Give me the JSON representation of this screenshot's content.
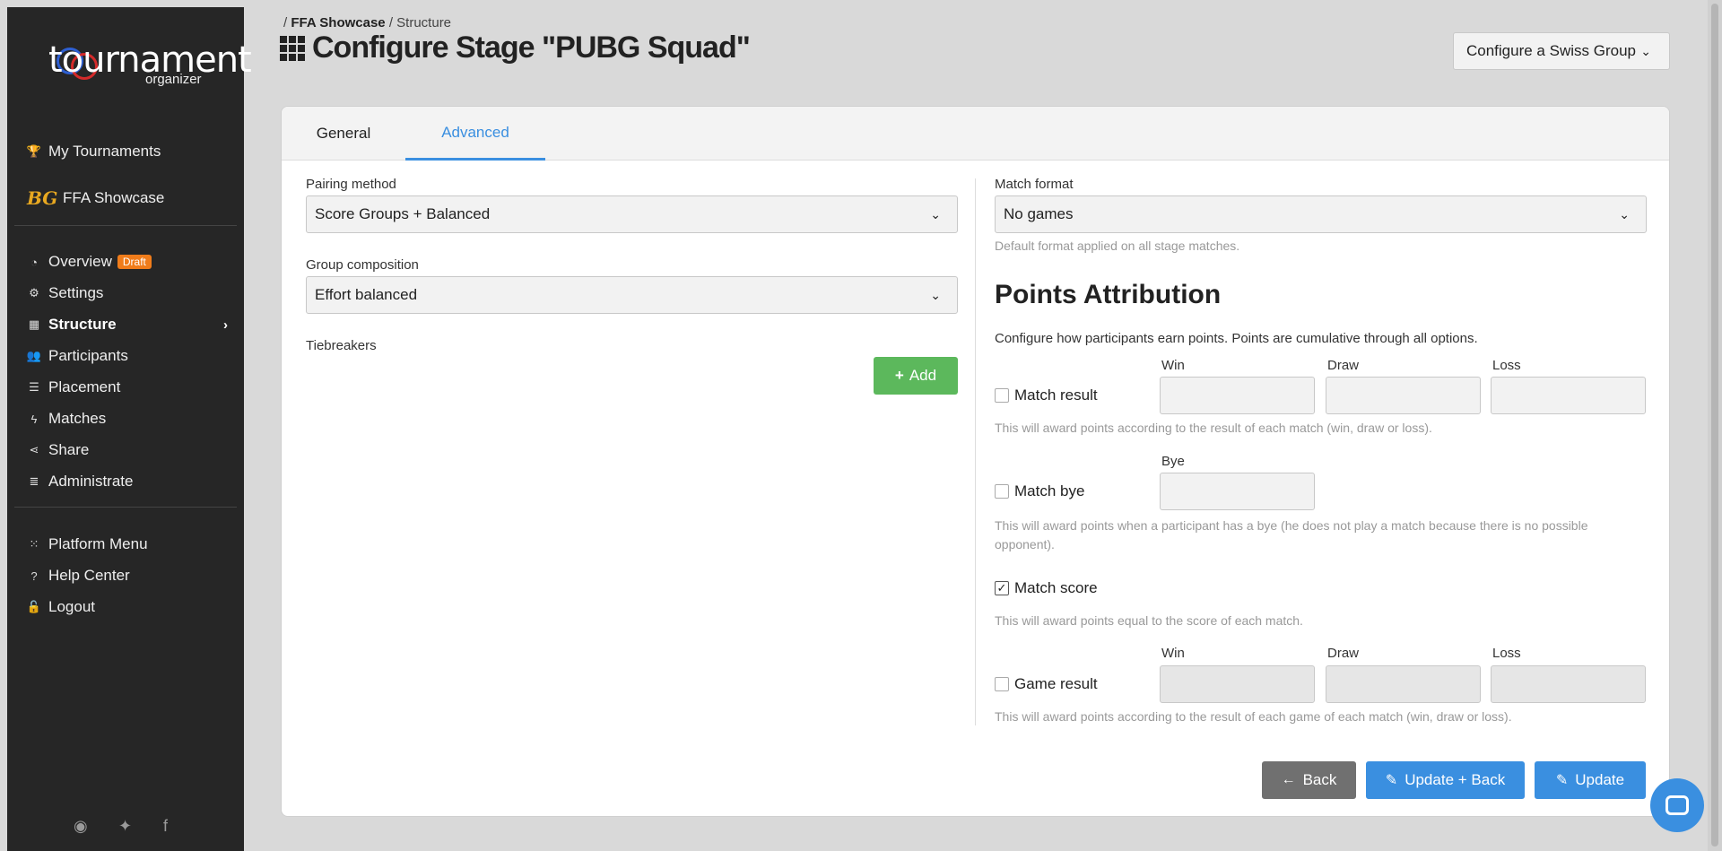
{
  "logo": {
    "word": "tournament",
    "sub": "organizer"
  },
  "sidebar": {
    "top": [
      {
        "label": "My Tournaments",
        "icon": "trophy-icon"
      }
    ],
    "tournament": {
      "label": "FFA Showcase",
      "logo_text": "BG"
    },
    "items": [
      {
        "label": "Overview",
        "icon": "dashboard-icon",
        "badge": "Draft"
      },
      {
        "label": "Settings",
        "icon": "gears-icon"
      },
      {
        "label": "Structure",
        "icon": "grid-icon",
        "active": true
      },
      {
        "label": "Participants",
        "icon": "users-icon"
      },
      {
        "label": "Placement",
        "icon": "list-icon"
      },
      {
        "label": "Matches",
        "icon": "bolt-icon"
      },
      {
        "label": "Share",
        "icon": "share-icon"
      },
      {
        "label": "Administrate",
        "icon": "database-icon"
      }
    ],
    "bottom": [
      {
        "label": "Platform Menu",
        "icon": "grid-icon"
      },
      {
        "label": "Help Center",
        "icon": "question-icon"
      },
      {
        "label": "Logout",
        "icon": "unlock-icon"
      }
    ],
    "social": [
      "discord-icon",
      "twitter-icon",
      "facebook-icon"
    ]
  },
  "breadcrumb": {
    "sep": "/",
    "tournament": "FFA Showcase",
    "current": "Structure"
  },
  "page": {
    "title": "Configure Stage \"PUBG Squad\"",
    "swiss_button": "Configure a Swiss Group"
  },
  "tabs": [
    {
      "label": "General",
      "active": false
    },
    {
      "label": "Advanced",
      "active": true
    }
  ],
  "left": {
    "pairing_label": "Pairing method",
    "pairing_value": "Score Groups + Balanced",
    "group_label": "Group composition",
    "group_value": "Effort balanced",
    "tiebreakers_label": "Tiebreakers",
    "add_button": "Add"
  },
  "right": {
    "match_format_label": "Match format",
    "match_format_value": "No games",
    "match_format_help": "Default format applied on all stage matches.",
    "points_title": "Points Attribution",
    "points_desc": "Configure how participants earn points. Points are cumulative through all options.",
    "col_win": "Win",
    "col_draw": "Draw",
    "col_loss": "Loss",
    "col_bye": "Bye",
    "match_result": {
      "label": "Match result",
      "checked": false,
      "help": "This will award points according to the result of each match (win, draw or loss)."
    },
    "match_bye": {
      "label": "Match bye",
      "checked": false,
      "help": "This will award points when a participant has a bye (he does not play a match because there is no possible opponent)."
    },
    "match_score": {
      "label": "Match score",
      "checked": true,
      "help": "This will award points equal to the score of each match."
    },
    "game_result": {
      "label": "Game result",
      "checked": false,
      "help": "This will award points according to the result of each game of each match (win, draw or loss)."
    }
  },
  "footer": {
    "back": "Back",
    "update_back": "Update + Back",
    "update": "Update"
  },
  "colors": {
    "accent": "#3a8fe0",
    "success": "#5cb85c",
    "badge": "#f07c1a",
    "sidebar": "#262626"
  }
}
